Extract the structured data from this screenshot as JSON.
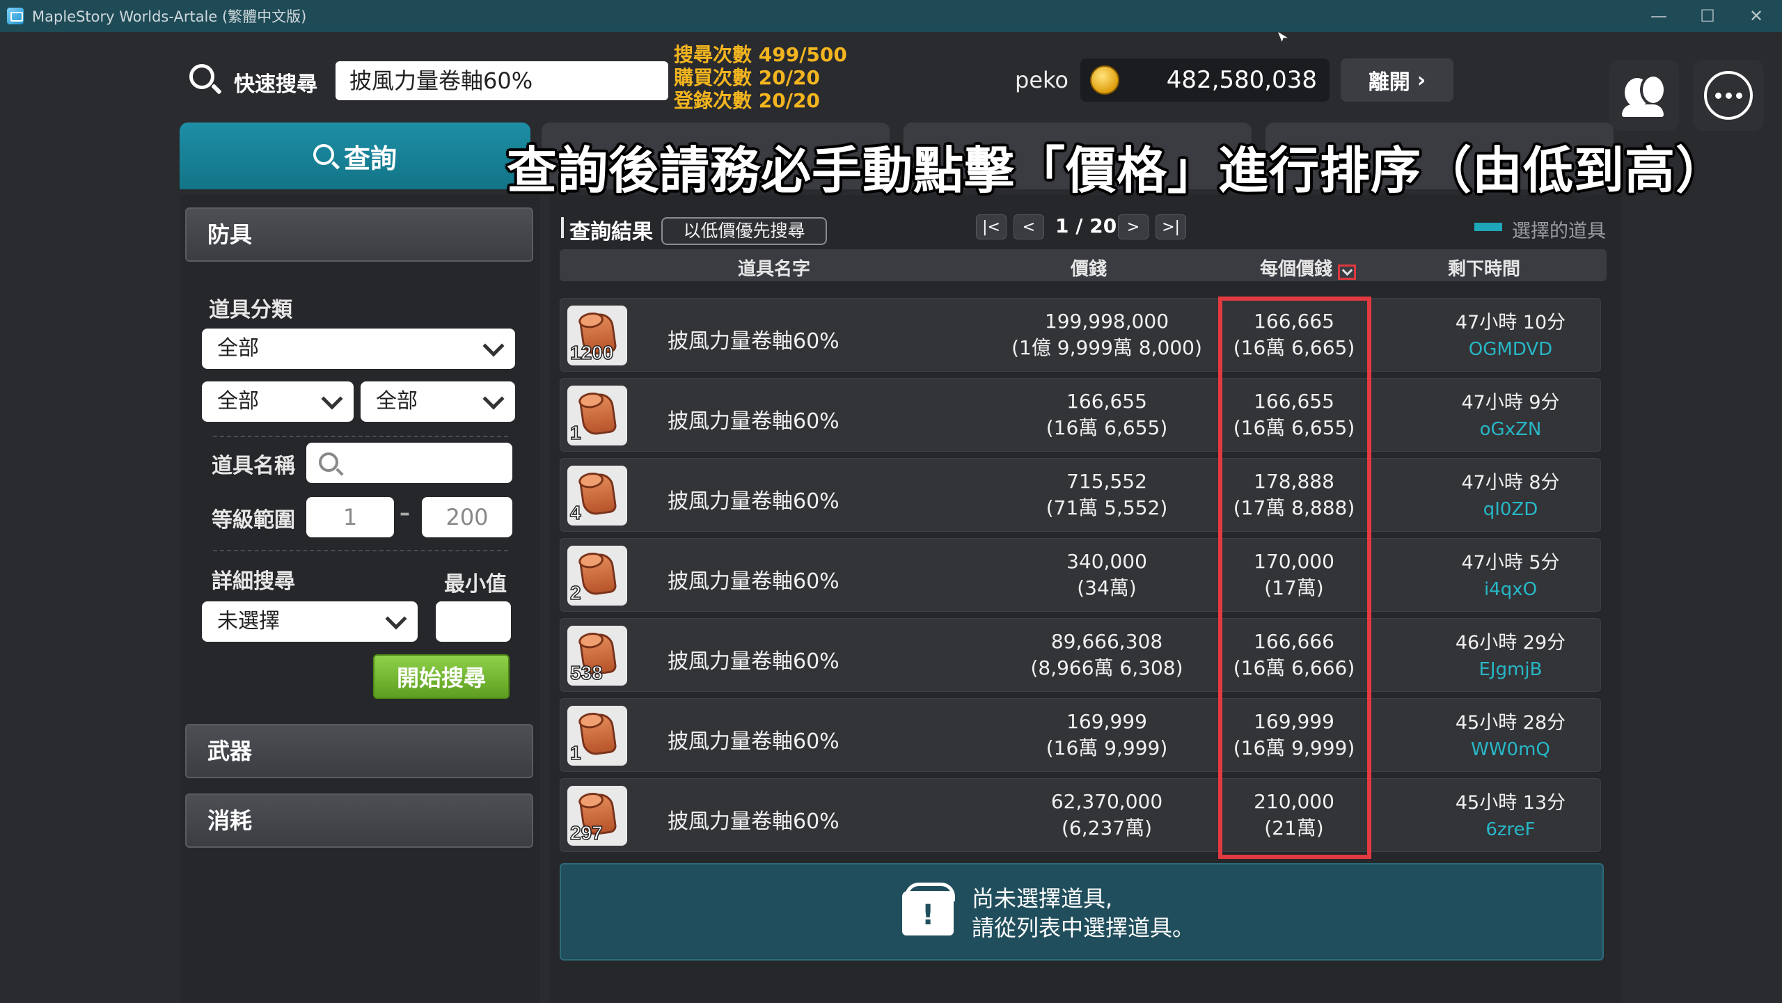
{
  "window": {
    "title": "MapleStory Worlds-Artale (繁體中文版)",
    "controls": [
      "—",
      "☐",
      "✕"
    ]
  },
  "topbar": {
    "quick_search_label": "快速搜尋",
    "quick_search_value": "披風力量卷軸60%",
    "counters": [
      "搜尋次數 499/500",
      "購買次數 20/20",
      "登錄次數 20/20"
    ],
    "username": "peko",
    "money": "482,580,038",
    "leave_label": "離開",
    "leave_chevron": "›"
  },
  "tabs": {
    "active_label": "查詢"
  },
  "overlay": {
    "caption": "查詢後請務必手動點擊「價格」進行排序（由低到高）"
  },
  "left": {
    "armor_header": "防具",
    "category_label": "道具分類",
    "category_value": "全部",
    "sub1_value": "全部",
    "sub2_value": "全部",
    "item_name_label": "道具名稱",
    "level_label": "等級範圍",
    "level_min": "1",
    "level_max": "200",
    "level_dash": "–",
    "detail_label": "詳細搜尋",
    "min_label": "最小值",
    "detail_value": "未選擇",
    "start_button": "開始搜尋",
    "weapon_header": "武器",
    "consume_header": "消耗"
  },
  "results": {
    "label": "查詢結果",
    "low_price_button": "以低價優先搜尋",
    "pager": {
      "first": "|<",
      "prev": "<",
      "text": "1 / 20",
      "next": ">",
      "last": ">|"
    },
    "selected_legend": "選擇的道具",
    "headers": {
      "name": "道具名字",
      "price": "價錢",
      "unit_price": "每個價錢",
      "time": "剩下時間"
    },
    "rows": [
      {
        "qty": "1200",
        "name": "披風力量卷軸60%",
        "price": "199,998,000",
        "price_sub": "(1億 9,999萬 8,000)",
        "unit": "166,665",
        "unit_sub": "(16萬 6,665)",
        "time": "47小時 10分",
        "seller": "OGMDVD"
      },
      {
        "qty": "1",
        "name": "披風力量卷軸60%",
        "price": "166,655",
        "price_sub": "(16萬 6,655)",
        "unit": "166,655",
        "unit_sub": "(16萬 6,655)",
        "time": "47小時 9分",
        "seller": "oGxZN"
      },
      {
        "qty": "4",
        "name": "披風力量卷軸60%",
        "price": "715,552",
        "price_sub": "(71萬 5,552)",
        "unit": "178,888",
        "unit_sub": "(17萬 8,888)",
        "time": "47小時 8分",
        "seller": "qI0ZD"
      },
      {
        "qty": "2",
        "name": "披風力量卷軸60%",
        "price": "340,000",
        "price_sub": "(34萬)",
        "unit": "170,000",
        "unit_sub": "(17萬)",
        "time": "47小時 5分",
        "seller": "i4qxO"
      },
      {
        "qty": "538",
        "name": "披風力量卷軸60%",
        "price": "89,666,308",
        "price_sub": "(8,966萬 6,308)",
        "unit": "166,666",
        "unit_sub": "(16萬 6,666)",
        "time": "46小時 29分",
        "seller": "EJgmjB"
      },
      {
        "qty": "1",
        "name": "披風力量卷軸60%",
        "price": "169,999",
        "price_sub": "(16萬 9,999)",
        "unit": "169,999",
        "unit_sub": "(16萬 9,999)",
        "time": "45小時 28分",
        "seller": "WW0mQ"
      },
      {
        "qty": "297",
        "name": "披風力量卷軸60%",
        "price": "62,370,000",
        "price_sub": "(6,237萬)",
        "unit": "210,000",
        "unit_sub": "(21萬)",
        "time": "45小時 13分",
        "seller": "6zreF"
      }
    ],
    "info_line1": "尚未選擇道具,",
    "info_line2": "請從列表中選擇道具。",
    "info_icon_glyph": "!"
  },
  "colors": {
    "accent_teal": "#1d8fa6",
    "highlight_red": "#e23a40",
    "counter_gold": "#f3b51f",
    "seller_cyan": "#27b7c6",
    "start_green": "#7cc23a"
  }
}
